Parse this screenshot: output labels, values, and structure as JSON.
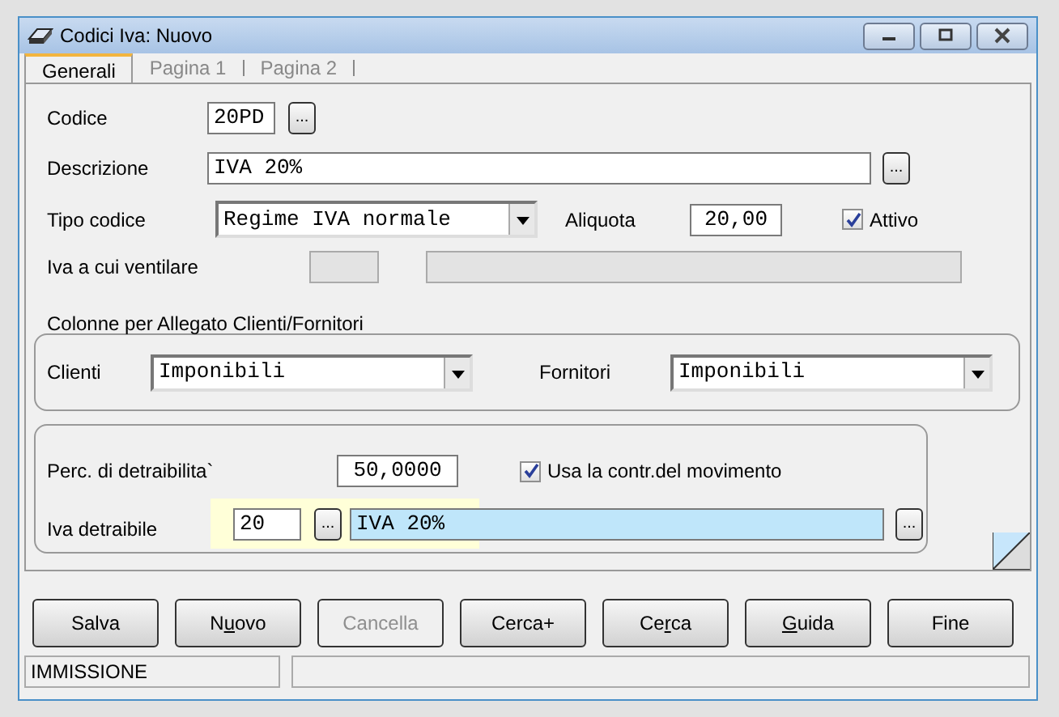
{
  "window": {
    "title": "Codici Iva: Nuovo"
  },
  "tabs": [
    {
      "label": "Generali",
      "selected": true
    },
    {
      "label": "Pagina 1",
      "selected": false
    },
    {
      "label": "Pagina 2",
      "selected": false
    }
  ],
  "codice": {
    "label": "Codice",
    "value": "20PD",
    "lookup": "..."
  },
  "descrizione": {
    "label": "Descrizione",
    "value": "IVA 20%",
    "lookup": "..."
  },
  "tipo_codice": {
    "label": "Tipo codice",
    "value": "Regime IVA normale"
  },
  "aliquota": {
    "label": "Aliquota",
    "value": "20,00"
  },
  "attivo": {
    "label": "Attivo",
    "checked": true
  },
  "ventilare": {
    "label": "Iva a cui ventilare",
    "disabled": true
  },
  "allegato": {
    "title": "Colonne per Allegato Clienti/Fornitori",
    "clienti": {
      "label": "Clienti",
      "value": "Imponibili"
    },
    "fornitori": {
      "label": "Fornitori",
      "value": "Imponibili"
    }
  },
  "detraibilita": {
    "label": "Perc. di detraibilita`",
    "value": "50,0000",
    "usa": {
      "label": "Usa la contr.del movimento",
      "checked": true
    }
  },
  "iva_detraibile": {
    "label": "Iva detraibile",
    "code": "20",
    "lookup": "...",
    "description": "IVA 20%",
    "lookup2": "..."
  },
  "buttons": [
    {
      "label": "Salva",
      "disabled": false
    },
    {
      "label": "N",
      "underlined": "u",
      "rest": "ovo",
      "disabled": false
    },
    {
      "label": "Cancella",
      "disabled": true
    },
    {
      "label": "Cerca+",
      "disabled": false
    },
    {
      "label": "Ce",
      "underlined": "r",
      "rest": "ca",
      "disabled": false
    },
    {
      "underlined": "G",
      "rest": "uida",
      "disabled": false
    },
    {
      "label": "Fine",
      "disabled": false
    }
  ],
  "status_bar": {
    "mode": "IMMISSIONE"
  }
}
